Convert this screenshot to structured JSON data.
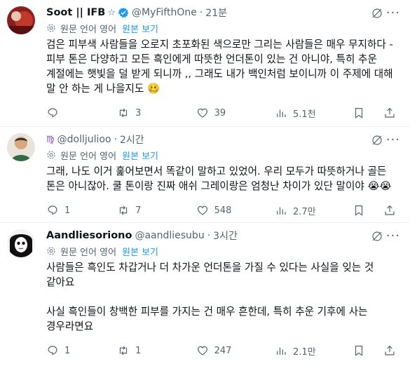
{
  "tweets": [
    {
      "name": "Soot || IFB",
      "badge": "☆",
      "handle": "@MyFifthOne",
      "time": "21분",
      "translate_label": "원문 언어 영어",
      "translate_action": "원본 보기",
      "text": "검은 피부색 사람들을 오로지 초포화된 색으로만 그리는 사람들은 매우 무지하다 - 피부 톤은 다양하고 모든 흑인에게 따뜻한 언더톤이 있는 건 아니야, 특히 추운 계절에는 햇빛을 덜 받게 되니까 ,, 그래도 내가 백인처럼 보이니까 이 주제에 대해 말 안 하는 게 나을지도 🥴",
      "reply_count": "",
      "retweet_count": "3",
      "like_count": "39",
      "view_count": "5.1천"
    },
    {
      "name": "",
      "badge": "♍",
      "handle": "@dolljulioo",
      "time": "2시간",
      "translate_label": "원문 언어 영어",
      "translate_action": "원본 보기",
      "text": "그래, 나도 이거 훑어보면서 똑같이 말하고 있었어. 우리 모두가 따뜻하거나 골든 톤은 아니잖아. 쿨 톤이랑 진짜 애쉬 그레이랑은 엄청난 차이가 있단 말이야 😭😭",
      "reply_count": "1",
      "retweet_count": "7",
      "like_count": "548",
      "view_count": "2.7만"
    },
    {
      "name": "Aandliesoriono",
      "badge": "",
      "handle": "@aandliesubu",
      "time": "3시간",
      "translate_label": "원문 언어 영어",
      "translate_action": "원본 보기",
      "text": "사람들은 흑인도 차갑거나 더 차가운 언더톤을 가질 수 있다는 사실을 잊는 것 같아요\n\n사실 흑인들이 창백한 피부를 가지는 건 매우 흔한데, 특히 추운 기후에 사는 경우라면요",
      "reply_count": "1",
      "retweet_count": "1",
      "like_count": "247",
      "view_count": "2.1만"
    }
  ]
}
